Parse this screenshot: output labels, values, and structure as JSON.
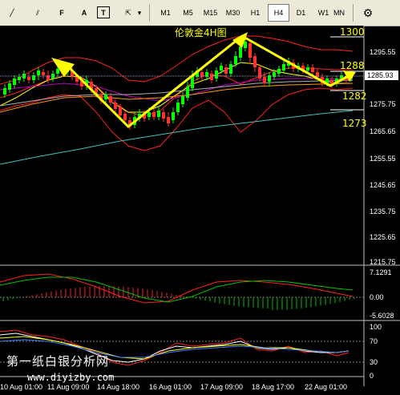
{
  "toolbar": {
    "tools": [
      {
        "name": "trendline-tool",
        "glyph": "╱"
      },
      {
        "name": "channel-tool",
        "glyph": "⫽"
      },
      {
        "name": "fibonacci-tool",
        "glyph": "F"
      },
      {
        "name": "text-tool",
        "glyph": "A"
      },
      {
        "name": "label-tool",
        "glyph": "T"
      },
      {
        "name": "arrows-tool",
        "glyph": "⇱"
      },
      {
        "name": "dropdown-arrow",
        "glyph": "▾"
      }
    ],
    "timeframes": [
      "M1",
      "M5",
      "M15",
      "M30",
      "H1",
      "H4",
      "D1",
      "W1",
      "MN"
    ],
    "active_timeframe": "H4",
    "settings_glyph": "⚙"
  },
  "chart": {
    "title_annotation": "伦敦金4H图",
    "level_labels": [
      "1300",
      "1288",
      "1282",
      "1273"
    ],
    "current_price": "1285.93",
    "price_axis": [
      "1295.55",
      "1285.65",
      "1275.75",
      "1265.65",
      "1255.55",
      "1245.65",
      "1235.75",
      "1225.65",
      "1215.75"
    ],
    "macd_axis": [
      "7.1291",
      "0.00",
      "-5.6028"
    ],
    "osc_axis": [
      "100",
      "70",
      "30",
      "0"
    ],
    "time_axis": [
      "10 Aug 01:00",
      "11 Aug 09:00",
      "14 Aug 18:00",
      "16 Aug 01:00",
      "17 Aug 09:00",
      "18 Aug 17:00",
      "22 Aug 01:00"
    ],
    "colors": {
      "bull": "#00ff00",
      "bear": "#ff3030",
      "annotation": "#ffff00",
      "ma_fast": "#ffff00",
      "ma_mid": "#c0c0c0",
      "ma_slow": "#40c0c0",
      "bollinger": "#ff2020"
    }
  },
  "watermark": {
    "text": "第一纸白银分析网",
    "url": "www.diyizby.com"
  }
}
